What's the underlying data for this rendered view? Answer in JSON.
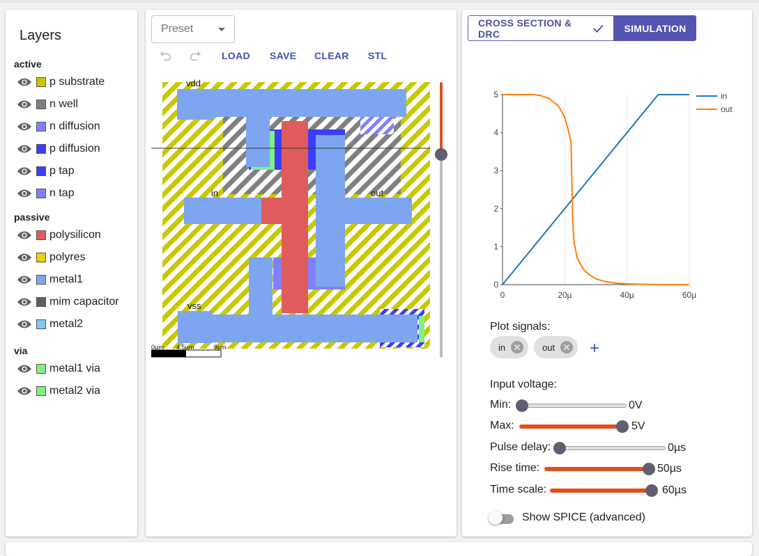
{
  "layers": {
    "title": "Layers",
    "groups": [
      {
        "name": "active",
        "items": [
          {
            "label": "p substrate",
            "color": "#c8c800"
          },
          {
            "label": "n well",
            "color": "#808080"
          },
          {
            "label": "n diffusion",
            "color": "#8080ff"
          },
          {
            "label": "p diffusion",
            "color": "#3c3cff"
          },
          {
            "label": "p tap",
            "color": "#3c3cff"
          },
          {
            "label": "n tap",
            "color": "#8080ff"
          }
        ]
      },
      {
        "name": "passive",
        "items": [
          {
            "label": "polysilicon",
            "color": "#e05c5c"
          },
          {
            "label": "polyres",
            "color": "#f0d000"
          },
          {
            "label": "metal1",
            "color": "#7ea6f0"
          },
          {
            "label": "mim capacitor",
            "color": "#606060"
          },
          {
            "label": "metal2",
            "color": "#80c8f8"
          }
        ]
      },
      {
        "name": "via",
        "items": [
          {
            "label": "metal1 via",
            "color": "#80f080"
          },
          {
            "label": "metal2 via",
            "color": "#80f080"
          }
        ]
      }
    ]
  },
  "editor": {
    "preset_placeholder": "Preset",
    "toolbar": {
      "load": "LOAD",
      "save": "SAVE",
      "clear": "CLEAR",
      "stl": "STL"
    },
    "labels": {
      "vdd": "vdd",
      "in": "in",
      "out": "out",
      "vss": "vss"
    },
    "scale": {
      "t0": "0µm",
      "t1": "4.5µm",
      "t2": "9µm"
    },
    "cross_section_slider": 0.74
  },
  "sim": {
    "tabs": {
      "cross_section": "CROSS SECTION & DRC",
      "simulation": "SIMULATION"
    },
    "plot_signals_label": "Plot signals:",
    "signals": [
      "in",
      "out"
    ],
    "input_voltage_label": "Input voltage:",
    "sliders": [
      {
        "label": "Min:",
        "value": "0V",
        "fraction": 0.0
      },
      {
        "label": "Max:",
        "value": "5V",
        "fraction": 1.0
      },
      {
        "label": "Pulse delay:",
        "value": "0µs",
        "fraction": 0.0
      },
      {
        "label": "Rise time:",
        "value": "50µs",
        "fraction": 1.0
      },
      {
        "label": "Time scale:",
        "value": "60µs",
        "fraction": 1.0
      }
    ],
    "spice_toggle_label": "Show SPICE (advanced)"
  },
  "colors": {
    "accent": "#3f51b5",
    "active_tab": "#5353b0",
    "slider_active": "#e0501e",
    "in_line": "#1f77b4",
    "out_line": "#ff7f0e"
  },
  "chart_data": {
    "type": "line",
    "x_ticks": [
      "0",
      "20µ",
      "40µ",
      "60µ"
    ],
    "y_ticks": [
      "0",
      "1",
      "2",
      "3",
      "4",
      "5"
    ],
    "xlim": [
      0,
      60
    ],
    "ylim": [
      0,
      5
    ],
    "x_unit": "µs",
    "legend": [
      "in",
      "out"
    ],
    "legend_position": "top-right",
    "grid": "vertical",
    "series": [
      {
        "name": "in",
        "color": "#1f77b4",
        "x": [
          0,
          50,
          60
        ],
        "y": [
          0,
          5,
          5
        ]
      },
      {
        "name": "out",
        "color": "#ff7f0e",
        "x": [
          0,
          10,
          12,
          15,
          18,
          20,
          21,
          22,
          22.5,
          23,
          24,
          26,
          28,
          30,
          33,
          36,
          40,
          45,
          50,
          55,
          60
        ],
        "y": [
          5,
          5,
          4.98,
          4.9,
          4.7,
          4.4,
          4.1,
          3.75,
          1.8,
          1.1,
          0.7,
          0.4,
          0.25,
          0.15,
          0.08,
          0.04,
          0.02,
          0.01,
          0.0,
          0.0,
          0.0
        ]
      }
    ]
  }
}
